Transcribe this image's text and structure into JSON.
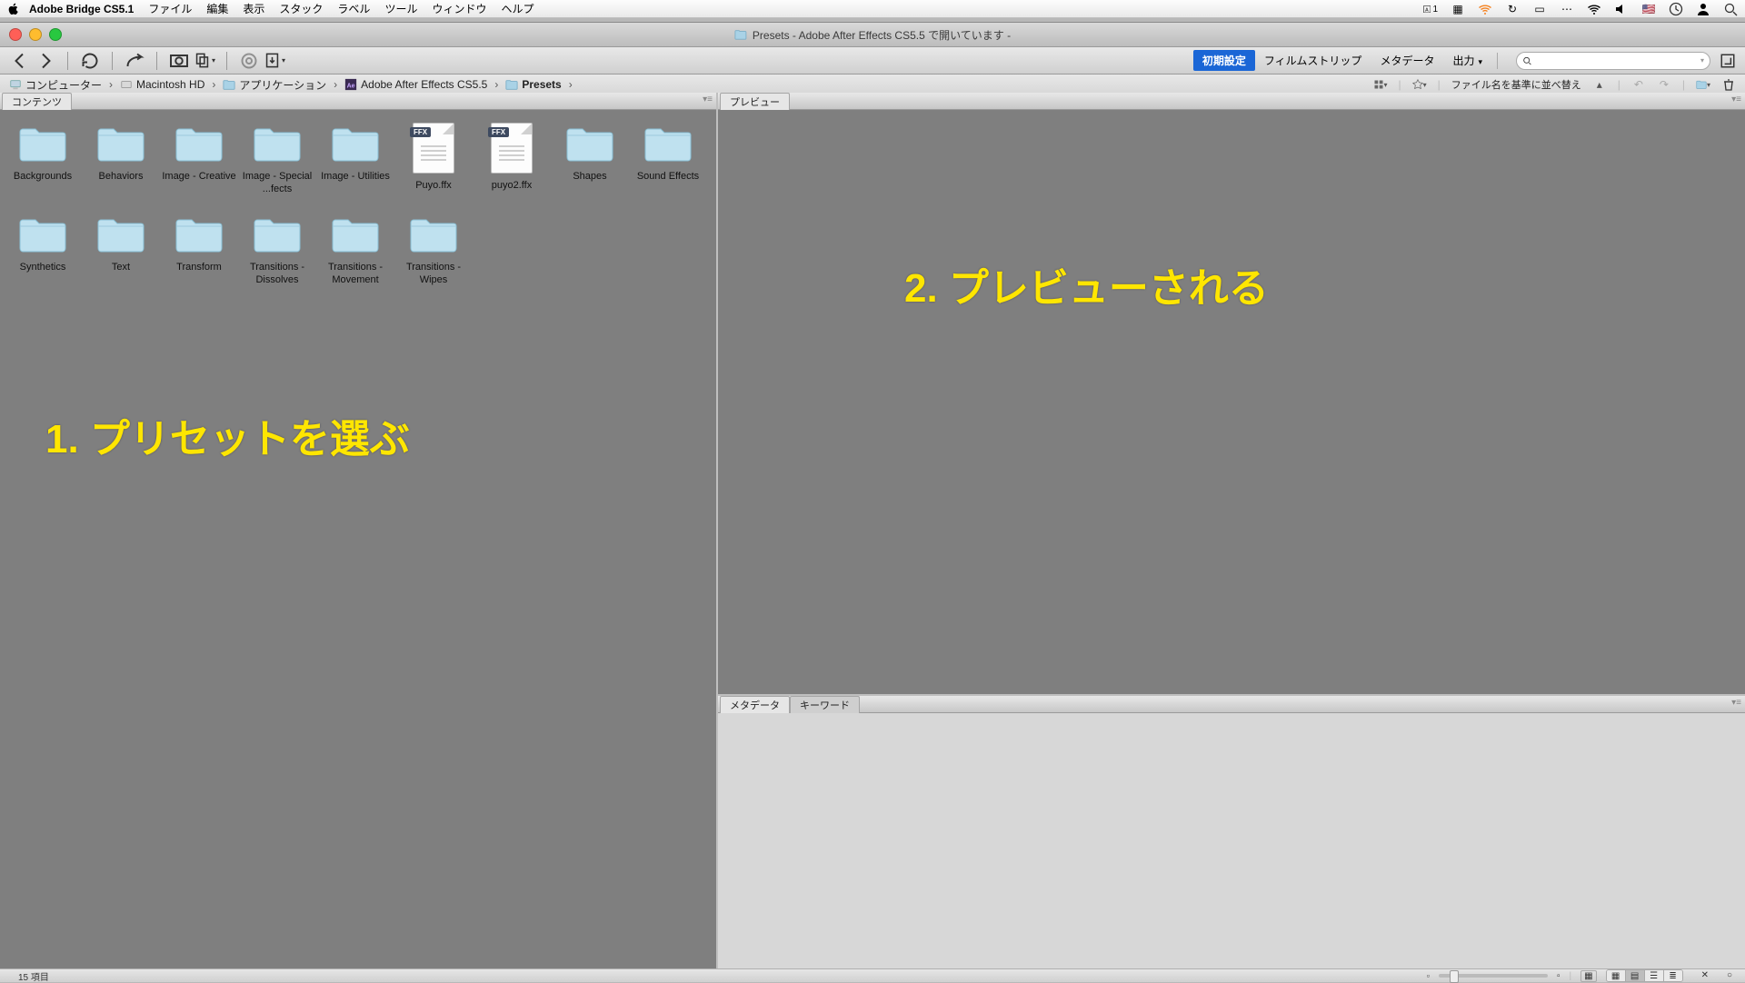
{
  "menubar": {
    "app": "Adobe Bridge CS5.1",
    "items": [
      "ファイル",
      "編集",
      "表示",
      "スタック",
      "ラベル",
      "ツール",
      "ウィンドウ",
      "ヘルプ"
    ],
    "status_badge": "1"
  },
  "window": {
    "title": "Presets - Adobe After Effects CS5.5 で開いています -"
  },
  "workspaces": {
    "default": "初期設定",
    "items": [
      "フィルムストリップ",
      "メタデータ",
      "出力"
    ]
  },
  "search": {
    "placeholder": ""
  },
  "breadcrumbs": [
    {
      "label": "コンピューター",
      "icon": "computer"
    },
    {
      "label": "Macintosh HD",
      "icon": "drive"
    },
    {
      "label": "アプリケーション",
      "icon": "folder"
    },
    {
      "label": "Adobe After Effects CS5.5",
      "icon": "app"
    },
    {
      "label": "Presets",
      "icon": "folder"
    }
  ],
  "sort_label": "ファイル名を基準に並べ替え",
  "panels": {
    "content_tab": "コンテンツ",
    "preview_tab": "プレビュー",
    "metadata_tab": "メタデータ",
    "keywords_tab": "キーワード"
  },
  "files": [
    {
      "name": "Backgrounds",
      "type": "folder"
    },
    {
      "name": "Behaviors",
      "type": "folder"
    },
    {
      "name": "Image - Creative",
      "type": "folder"
    },
    {
      "name": "Image - Special ...fects",
      "type": "folder"
    },
    {
      "name": "Image - Utilities",
      "type": "folder"
    },
    {
      "name": "Puyo.ffx",
      "type": "ffx"
    },
    {
      "name": "puyo2.ffx",
      "type": "ffx"
    },
    {
      "name": "Shapes",
      "type": "folder"
    },
    {
      "name": "Sound Effects",
      "type": "folder"
    },
    {
      "name": "Synthetics",
      "type": "folder"
    },
    {
      "name": "Text",
      "type": "folder"
    },
    {
      "name": "Transform",
      "type": "folder"
    },
    {
      "name": "Transitions - Dissolves",
      "type": "folder"
    },
    {
      "name": "Transitions - Movement",
      "type": "folder"
    },
    {
      "name": "Transitions - Wipes",
      "type": "folder"
    }
  ],
  "annotations": {
    "a1": "1. プリセットを選ぶ",
    "a2": "2. プレビューされる"
  },
  "ffx_badge": "FFX",
  "status": {
    "count": "15 項目"
  }
}
